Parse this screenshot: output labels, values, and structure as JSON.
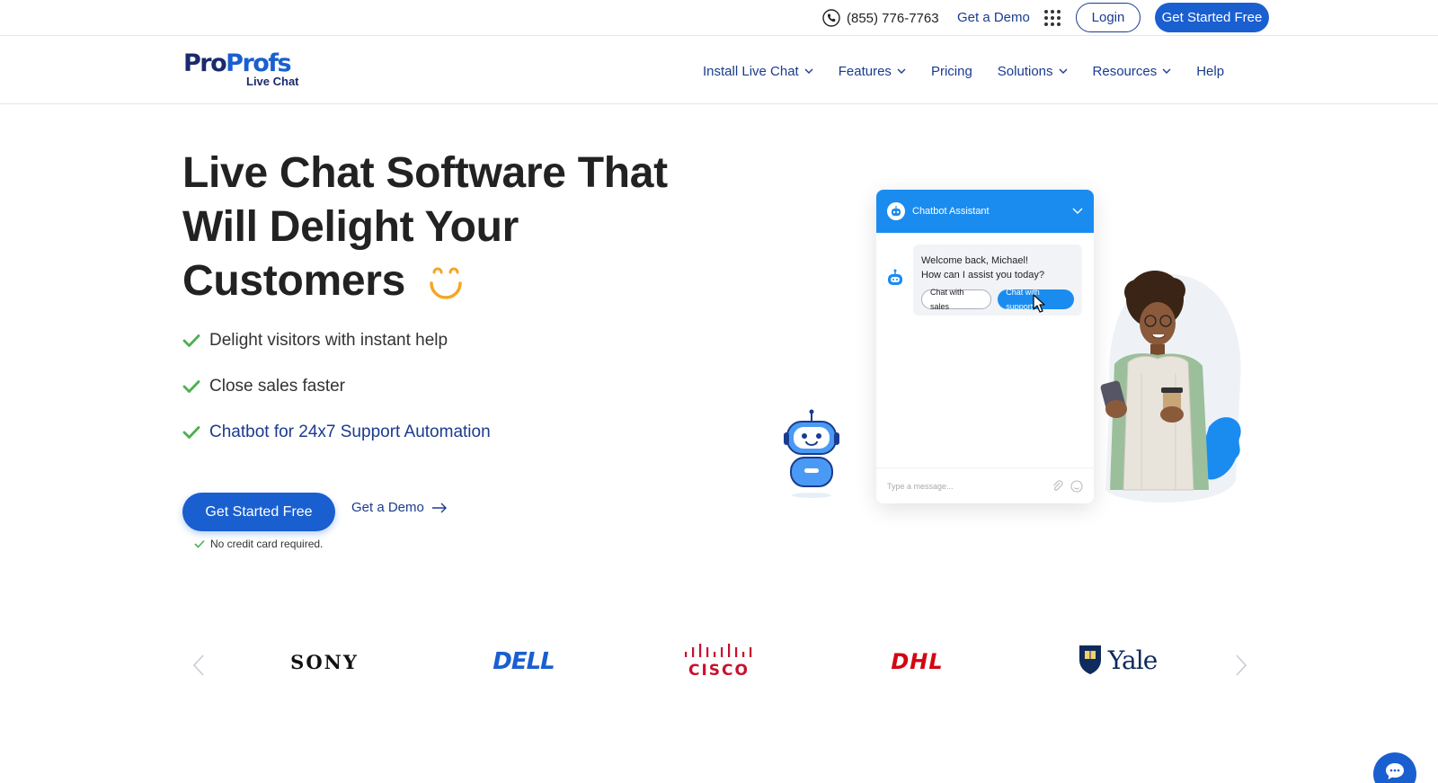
{
  "topbar": {
    "phone": "(855) 776-7763",
    "demo_link": "Get a Demo",
    "login": "Login",
    "get_started": "Get Started Free"
  },
  "logo": {
    "brand_pro": "Pro",
    "brand_profs": "Profs",
    "product": "Live Chat"
  },
  "nav": {
    "items": [
      {
        "label": "Install Live Chat",
        "dropdown": true
      },
      {
        "label": "Features",
        "dropdown": true
      },
      {
        "label": "Pricing",
        "dropdown": false
      },
      {
        "label": "Solutions",
        "dropdown": true
      },
      {
        "label": "Resources",
        "dropdown": true
      },
      {
        "label": "Help",
        "dropdown": false
      }
    ]
  },
  "hero": {
    "title_line1": "Live Chat Software That",
    "title_line2": "Will Delight Your",
    "title_line3": "Customers",
    "features": [
      "Delight visitors with instant help",
      "Close sales faster",
      "Chatbot for 24x7 Support Automation"
    ],
    "cta_primary": "Get Started Free",
    "cta_demo": "Get a Demo",
    "no_credit_card": "No credit card required."
  },
  "chat_widget": {
    "header_title": "Chatbot Assistant",
    "message_line1": "Welcome back, Michael!",
    "message_line2": "How can I assist you today?",
    "option_sales": "Chat with sales",
    "option_support": "Chat with support",
    "input_placeholder": "Type a message..."
  },
  "logos": {
    "sony": "SONY",
    "dell": "DELL",
    "cisco": "CISCO",
    "dhl": "DHL",
    "yale": "Yale"
  },
  "colors": {
    "primary_blue": "#1a5fd0",
    "nav_blue": "#1a3b8f",
    "check_green": "#4caf50",
    "chat_blue": "#1a8cf0",
    "smile_orange": "#f5a623"
  }
}
